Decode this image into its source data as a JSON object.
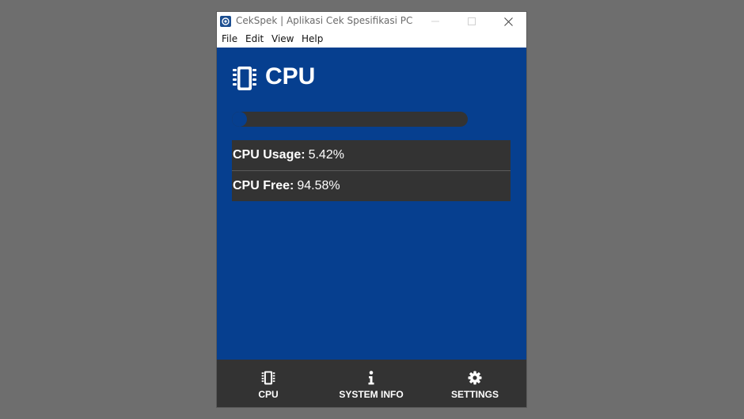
{
  "window": {
    "title": "CekSpek | Aplikasi Cek Spesifikasi PC"
  },
  "menubar": {
    "items": [
      "File",
      "Edit",
      "View",
      "Help"
    ]
  },
  "main": {
    "title": "CPU",
    "title_icon": "chip-icon",
    "usage_progress_percent": 5.42,
    "stats": [
      {
        "label": "CPU Usage:",
        "value": "5.42%"
      },
      {
        "label": "CPU Free:",
        "value": "94.58%"
      }
    ]
  },
  "bottom_nav": {
    "items": [
      {
        "label": "CPU",
        "icon": "chip-icon"
      },
      {
        "label": "SYSTEM INFO",
        "icon": "info-icon"
      },
      {
        "label": "SETTINGS",
        "icon": "gear-icon"
      }
    ]
  },
  "colors": {
    "content_background": "#063f8f",
    "panel": "#333333",
    "desktop": "#6e6e6e",
    "text": "#ffffff"
  }
}
